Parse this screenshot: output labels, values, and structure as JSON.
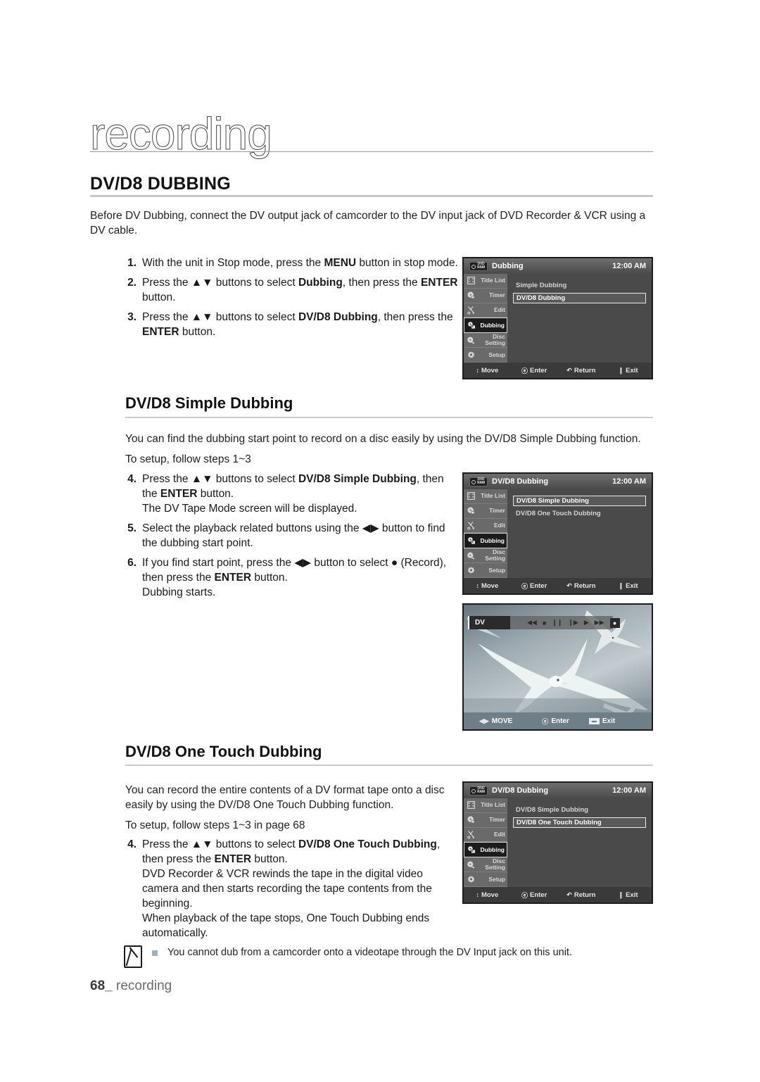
{
  "masthead": {
    "title": "recording"
  },
  "section1": {
    "heading": "DV/D8 DUBBING",
    "intro": "Before DV Dubbing, connect the DV output jack of camcorder to the DV input jack of DVD Recorder & VCR using a DV cable.",
    "steps": [
      {
        "num": "1.",
        "pre": "With the unit in Stop mode, press the ",
        "bold1": "MENU",
        "mid": " button in stop mode.",
        "bold2": "",
        "post": ""
      },
      {
        "num": "2.",
        "pre": "Press the ▲▼ buttons to select ",
        "bold1": "Dubbing",
        "mid": ", then press the ",
        "bold2": "ENTER",
        "post": " button."
      },
      {
        "num": "3.",
        "pre": "Press the ▲▼ buttons to select ",
        "bold1": "DV/D8 Dubbing",
        "mid": ", then press the ",
        "bold2": "ENTER",
        "post": " button."
      }
    ]
  },
  "section2": {
    "heading": "DV/D8 Simple Dubbing",
    "intro": "You can find the dubbing start point to record on a disc easily by using the DV/D8 Simple Dubbing function.",
    "setup_note": "To setup, follow steps 1~3",
    "steps": [
      {
        "num": "4.",
        "pre": "Press the ▲▼ buttons to select ",
        "bold1": "DV/D8 Simple Dubbing",
        "mid": ", then the ",
        "bold2": "ENTER",
        "post": " button.",
        "extra": "The DV Tape Mode screen will be displayed."
      },
      {
        "num": "5.",
        "pre": "Select the playback related buttons using the ◀▶ button to find the dubbing start point.",
        "bold1": "",
        "mid": "",
        "bold2": "",
        "post": "",
        "extra": ""
      },
      {
        "num": "6.",
        "pre": "If you find start point, press the ◀▶ button to select ● (Record), then press the ",
        "bold1": "",
        "mid": "",
        "bold2": "ENTER",
        "post": " button.",
        "extra": "Dubbing starts."
      }
    ]
  },
  "section3": {
    "heading": "DV/D8 One Touch Dubbing",
    "intro": "You can record the entire contents of a DV format tape onto a disc easily by using the DV/D8 One Touch Dubbing function.",
    "setup_note": "To setup, follow steps 1~3 in page 68",
    "steps": [
      {
        "num": "4.",
        "pre": "Press the ▲▼ buttons to select ",
        "bold1": "DV/D8 One Touch Dubbing",
        "mid": ", then press the ",
        "bold2": "ENTER",
        "post": " button.",
        "extra": "DVD Recorder & VCR rewinds the tape in the digital video camera and then starts recording the tape contents from the beginning.",
        "extra2": "When playback of the tape stops, One Touch Dubbing ends automatically."
      }
    ]
  },
  "osd_common": {
    "clock": "12:00 AM",
    "badge_line1": "DVD",
    "badge_line2": "RAM",
    "sidebar": [
      {
        "label": "Title List",
        "icon": "film-strip-icon"
      },
      {
        "label": "Timer",
        "icon": "clock-disc-icon"
      },
      {
        "label": "Edit",
        "icon": "scissors-icon"
      },
      {
        "label": "Dubbing",
        "icon": "dubbing-icon"
      },
      {
        "label": "Disc Setting",
        "icon": "disc-pen-icon"
      },
      {
        "label": "Setup",
        "icon": "gear-icon"
      }
    ],
    "footer": [
      {
        "glyph": "↕",
        "label": "Move"
      },
      {
        "glyph": "ⓔ",
        "label": "Enter"
      },
      {
        "glyph": "↶",
        "label": "Return"
      },
      {
        "glyph": "❙",
        "label": "Exit"
      }
    ]
  },
  "osd1": {
    "title": "Dubbing",
    "rows": [
      {
        "label": "Simple Dubbing",
        "selected": false
      },
      {
        "label": "DV/D8 Dubbing",
        "selected": true
      }
    ]
  },
  "osd2": {
    "title": "DV/D8 Dubbing",
    "rows": [
      {
        "label": "DV/D8 Simple Dubbing",
        "selected": true
      },
      {
        "label": "DV/D8 One Touch Dubbing",
        "selected": false
      }
    ]
  },
  "osd3": {
    "title": "DV/D8 Dubbing",
    "rows": [
      {
        "label": "DV/D8 Simple Dubbing",
        "selected": false
      },
      {
        "label": "DV/D8 One Touch Dubbing",
        "selected": true
      }
    ]
  },
  "dv_screen": {
    "source_label": "DV",
    "controls": [
      {
        "name": "rewind-icon",
        "glyph": "◀◀",
        "selected": false
      },
      {
        "name": "stop-icon",
        "glyph": "■",
        "selected": false
      },
      {
        "name": "pause-icon",
        "glyph": "❙❙",
        "selected": false
      },
      {
        "name": "frame-advance-icon",
        "glyph": "❙▶",
        "selected": false
      },
      {
        "name": "play-icon",
        "glyph": "▶",
        "selected": false
      },
      {
        "name": "fast-forward-icon",
        "glyph": "▶▶",
        "selected": false
      },
      {
        "name": "record-icon",
        "glyph": "●",
        "selected": true
      }
    ],
    "footer": [
      {
        "glyph": "◀▶",
        "label": "MOVE"
      },
      {
        "glyph": "ⓔ",
        "label": "Enter"
      },
      {
        "glyph": "▬",
        "label": "Exit"
      }
    ]
  },
  "note": {
    "text": "You cannot dub from a camcorder onto a videotape through the DV Input jack on this unit."
  },
  "footer": {
    "page_number": "68",
    "underscore": "_",
    "chapter": "recording"
  }
}
